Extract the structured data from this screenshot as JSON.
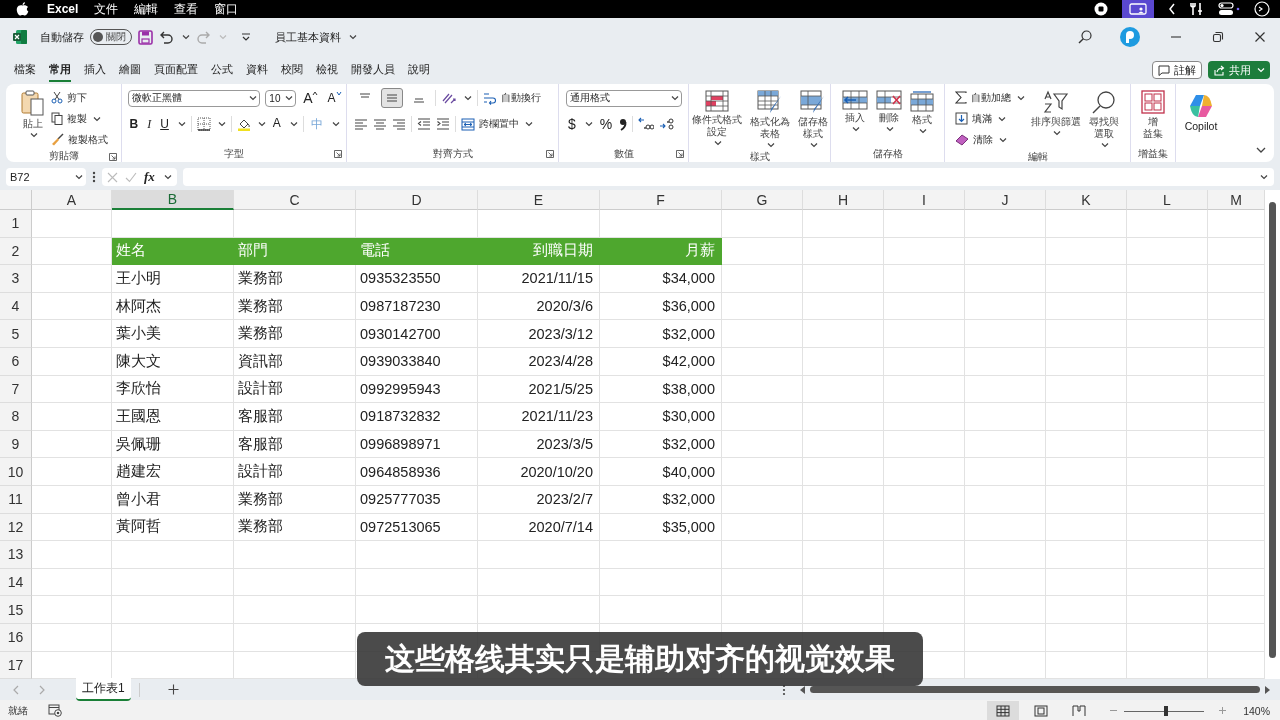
{
  "menubar": {
    "app": "Excel",
    "items": [
      "文件",
      "編輯",
      "查看",
      "窗口"
    ]
  },
  "titlebar": {
    "autosave_label": "自動儲存",
    "autosave": {
      "label": "關閉",
      "on": false
    },
    "document": "員工基本資料"
  },
  "ribbon_tabs": [
    {
      "label": "檔案",
      "selected": false
    },
    {
      "label": "常用",
      "selected": true
    },
    {
      "label": "插入",
      "selected": false
    },
    {
      "label": "繪圖",
      "selected": false
    },
    {
      "label": "頁面配置",
      "selected": false
    },
    {
      "label": "公式",
      "selected": false
    },
    {
      "label": "資料",
      "selected": false
    },
    {
      "label": "校閱",
      "selected": false
    },
    {
      "label": "檢視",
      "selected": false
    },
    {
      "label": "開發人員",
      "selected": false
    },
    {
      "label": "說明",
      "selected": false
    }
  ],
  "actions": {
    "comments": "註解",
    "share": "共用"
  },
  "ribbon": {
    "groups": [
      {
        "kind": "clipboard",
        "label": "剪貼簿",
        "paste": "貼上",
        "items": [
          "剪下",
          "複製",
          "複製格式"
        ]
      },
      {
        "kind": "font",
        "label": "字型",
        "font": "微軟正黑體",
        "size": "10",
        "grow": "A",
        "shrink": "A",
        "styles": [
          "B",
          "I",
          "U"
        ],
        "color_letter": "A",
        "phonetic": "中"
      },
      {
        "kind": "alignment",
        "label": "對齊方式",
        "valign": [
          {
            "selected": false
          },
          {
            "selected": true
          },
          {
            "selected": false
          }
        ],
        "wrap": "自動換行",
        "merge": "跨欄置中"
      },
      {
        "kind": "number",
        "label": "數值",
        "format": "通用格式",
        "currency": "$",
        "percent": "%"
      },
      {
        "kind": "styles",
        "label": "樣式",
        "buttons": [
          {
            "lines": [
              "條件式格式",
              "設定"
            ]
          },
          {
            "lines": [
              "格式化為",
              "表格"
            ]
          },
          {
            "lines": [
              "儲存格",
              "樣式"
            ]
          }
        ]
      },
      {
        "kind": "cells",
        "label": "儲存格",
        "buttons": [
          {
            "lines": [
              "插入"
            ]
          },
          {
            "lines": [
              "刪除"
            ]
          },
          {
            "lines": [
              "格式"
            ]
          }
        ]
      },
      {
        "kind": "editing",
        "label": "編輯",
        "items": [
          "自動加總",
          "填滿",
          "清除"
        ],
        "buttons": [
          {
            "lines": [
              "排序與篩選"
            ]
          },
          {
            "lines": [
              "尋找與",
              "選取"
            ]
          }
        ]
      },
      {
        "kind": "addins",
        "label": "增益集",
        "lines": [
          "增",
          "益集"
        ]
      },
      {
        "kind": "copilot",
        "button": "Copilot"
      }
    ]
  },
  "formula_bar": {
    "name_box": "B72",
    "fx": "fx"
  },
  "sheet": {
    "columns": [
      {
        "label": "A",
        "selected": false
      },
      {
        "label": "B",
        "selected": true
      },
      {
        "label": "C",
        "selected": false
      },
      {
        "label": "D",
        "selected": false
      },
      {
        "label": "E",
        "selected": false
      },
      {
        "label": "F",
        "selected": false
      },
      {
        "label": "G",
        "selected": false
      },
      {
        "label": "H",
        "selected": false
      },
      {
        "label": "I",
        "selected": false
      },
      {
        "label": "J",
        "selected": false
      },
      {
        "label": "K",
        "selected": false
      },
      {
        "label": "L",
        "selected": false
      },
      {
        "label": "M",
        "selected": false
      }
    ],
    "rows": [
      {
        "number": "1"
      },
      {
        "number": "2",
        "header": true,
        "cells": [
          "姓名",
          "部門",
          "電話",
          "到職日期",
          "月薪"
        ]
      },
      {
        "number": "3",
        "header": false,
        "cells": [
          "王小明",
          "業務部",
          "0935323550",
          "2021/11/15",
          "$34,000"
        ]
      },
      {
        "number": "4",
        "header": false,
        "cells": [
          "林阿杰",
          "業務部",
          "0987187230",
          "2020/3/6",
          "$36,000"
        ]
      },
      {
        "number": "5",
        "header": false,
        "cells": [
          "葉小美",
          "業務部",
          "0930142700",
          "2023/3/12",
          "$32,000"
        ]
      },
      {
        "number": "6",
        "header": false,
        "cells": [
          "陳大文",
          "資訊部",
          "0939033840",
          "2023/4/28",
          "$42,000"
        ]
      },
      {
        "number": "7",
        "header": false,
        "cells": [
          "李欣怡",
          "設計部",
          "0992995943",
          "2021/5/25",
          "$38,000"
        ]
      },
      {
        "number": "8",
        "header": false,
        "cells": [
          "王國恩",
          "客服部",
          "0918732832",
          "2021/11/23",
          "$30,000"
        ]
      },
      {
        "number": "9",
        "header": false,
        "cells": [
          "吳佩珊",
          "客服部",
          "0996898971",
          "2023/3/5",
          "$32,000"
        ]
      },
      {
        "number": "10",
        "header": false,
        "cells": [
          "趙建宏",
          "設計部",
          "0964858936",
          "2020/10/20",
          "$40,000"
        ]
      },
      {
        "number": "11",
        "header": false,
        "cells": [
          "曾小君",
          "業務部",
          "0925777035",
          "2023/2/7",
          "$32,000"
        ]
      },
      {
        "number": "12",
        "header": false,
        "cells": [
          "黃阿哲",
          "業務部",
          "0972513065",
          "2020/7/14",
          "$35,000"
        ]
      },
      {
        "number": "13"
      },
      {
        "number": "14"
      },
      {
        "number": "15"
      },
      {
        "number": "16"
      },
      {
        "number": "17"
      }
    ]
  },
  "sheet_tabs": [
    {
      "label": "工作表1",
      "selected": true
    }
  ],
  "status_bar": {
    "status": "就緒",
    "views": [
      {
        "selected": true
      },
      {
        "selected": false
      },
      {
        "selected": false
      }
    ],
    "zoom": {
      "level": 0.52,
      "label": "140%"
    }
  },
  "subtitle": "这些格线其实只是辅助对齐的视觉效果"
}
